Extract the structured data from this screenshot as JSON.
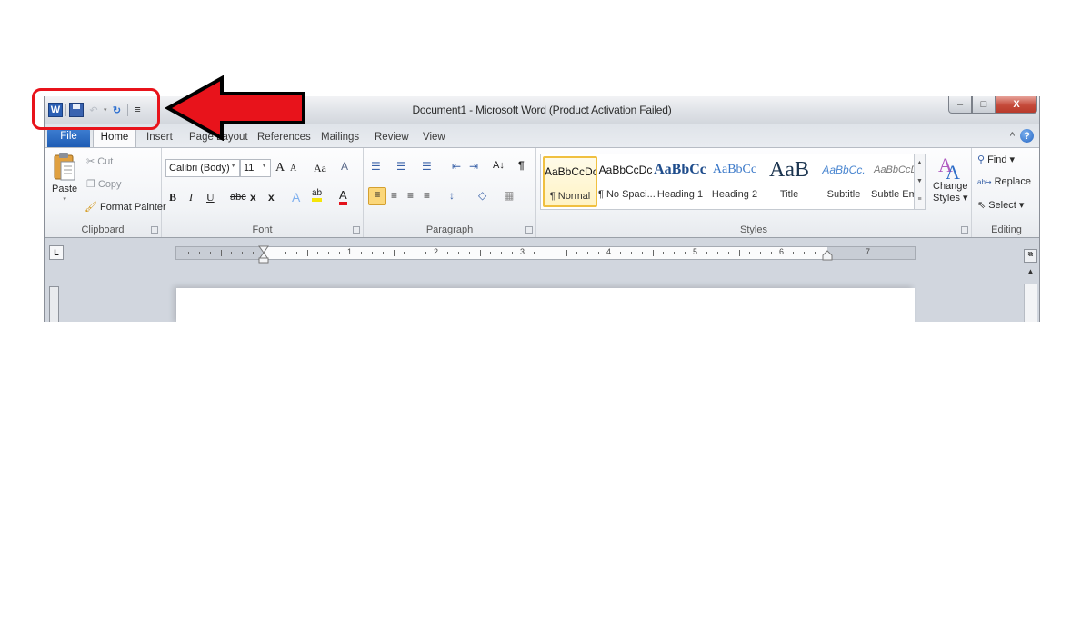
{
  "window": {
    "title": "Document1  -  Microsoft Word (Product Activation Failed)",
    "controls": {
      "minimize": "–",
      "maximize": "□",
      "close": "X"
    }
  },
  "quick_access_toolbar": {
    "items": [
      {
        "name": "word-icon",
        "glyph": "W"
      },
      {
        "name": "save-icon",
        "glyph": ""
      },
      {
        "name": "undo-icon",
        "glyph": "↶"
      },
      {
        "name": "redo-icon",
        "glyph": "↻"
      },
      {
        "name": "customize-icon",
        "glyph": "≡"
      }
    ],
    "dropdown_glyph": "▾"
  },
  "tabs": [
    "File",
    "Home",
    "Insert",
    "Page Layout",
    "References",
    "Mailings",
    "Review",
    "View"
  ],
  "help": {
    "minimize_ribbon": "^",
    "help": "?"
  },
  "ribbon": {
    "clipboard": {
      "label": "Clipboard",
      "paste": "Paste",
      "paste_arrow": "▾",
      "cut": "Cut",
      "copy": "Copy",
      "format_painter": "Format Painter"
    },
    "font": {
      "label": "Font",
      "font_name": "Calibri (Body)",
      "font_size": "11",
      "grow": "A",
      "shrink": "A",
      "change_case": "Aa",
      "clear": "A",
      "bold": "B",
      "italic": "I",
      "underline": "U",
      "strikethrough": "abc",
      "subscript": "x",
      "superscript": "x",
      "text_effects": "A",
      "highlight": "ab",
      "font_color": "A",
      "highlight_color": "#f5e50a",
      "font_color_value": "#e3121b"
    },
    "paragraph": {
      "label": "Paragraph",
      "bullets": "☰",
      "numbering": "☰",
      "multilevel": "☰",
      "decrease_indent": "⇤",
      "increase_indent": "⇥",
      "sort": "A↓",
      "show_marks": "¶",
      "align_left": "≡",
      "center": "≡",
      "align_right": "≡",
      "justify": "≡",
      "line_spacing": "↕",
      "shading": "◇",
      "borders": "▦"
    },
    "styles": {
      "label": "Styles",
      "items": [
        {
          "preview": "AaBbCcDc",
          "name": "¶ Normal",
          "selected": true
        },
        {
          "preview": "AaBbCcDc",
          "name": "¶ No Spaci...",
          "selected": false
        },
        {
          "preview": "AaBbCc",
          "name": "Heading 1",
          "selected": false
        },
        {
          "preview": "AaBbCc",
          "name": "Heading 2",
          "selected": false
        },
        {
          "preview": "AaB",
          "name": "Title",
          "selected": false
        },
        {
          "preview": "AaBbCc.",
          "name": "Subtitle",
          "selected": false
        },
        {
          "preview": "AaBbCcDc",
          "name": "Subtle Em...",
          "selected": false
        }
      ],
      "change_styles_line1": "Change",
      "change_styles_line2": "Styles ▾"
    },
    "editing": {
      "label": "Editing",
      "find": "Find ▾",
      "replace": "Replace",
      "select": "Select ▾"
    }
  },
  "ruler": {
    "tab_selector": "L",
    "numbers": [
      "1",
      "2",
      "3",
      "4",
      "5",
      "6",
      "7"
    ]
  },
  "annotation": {
    "color": "#e8131b",
    "target": "Quick Access Toolbar"
  }
}
